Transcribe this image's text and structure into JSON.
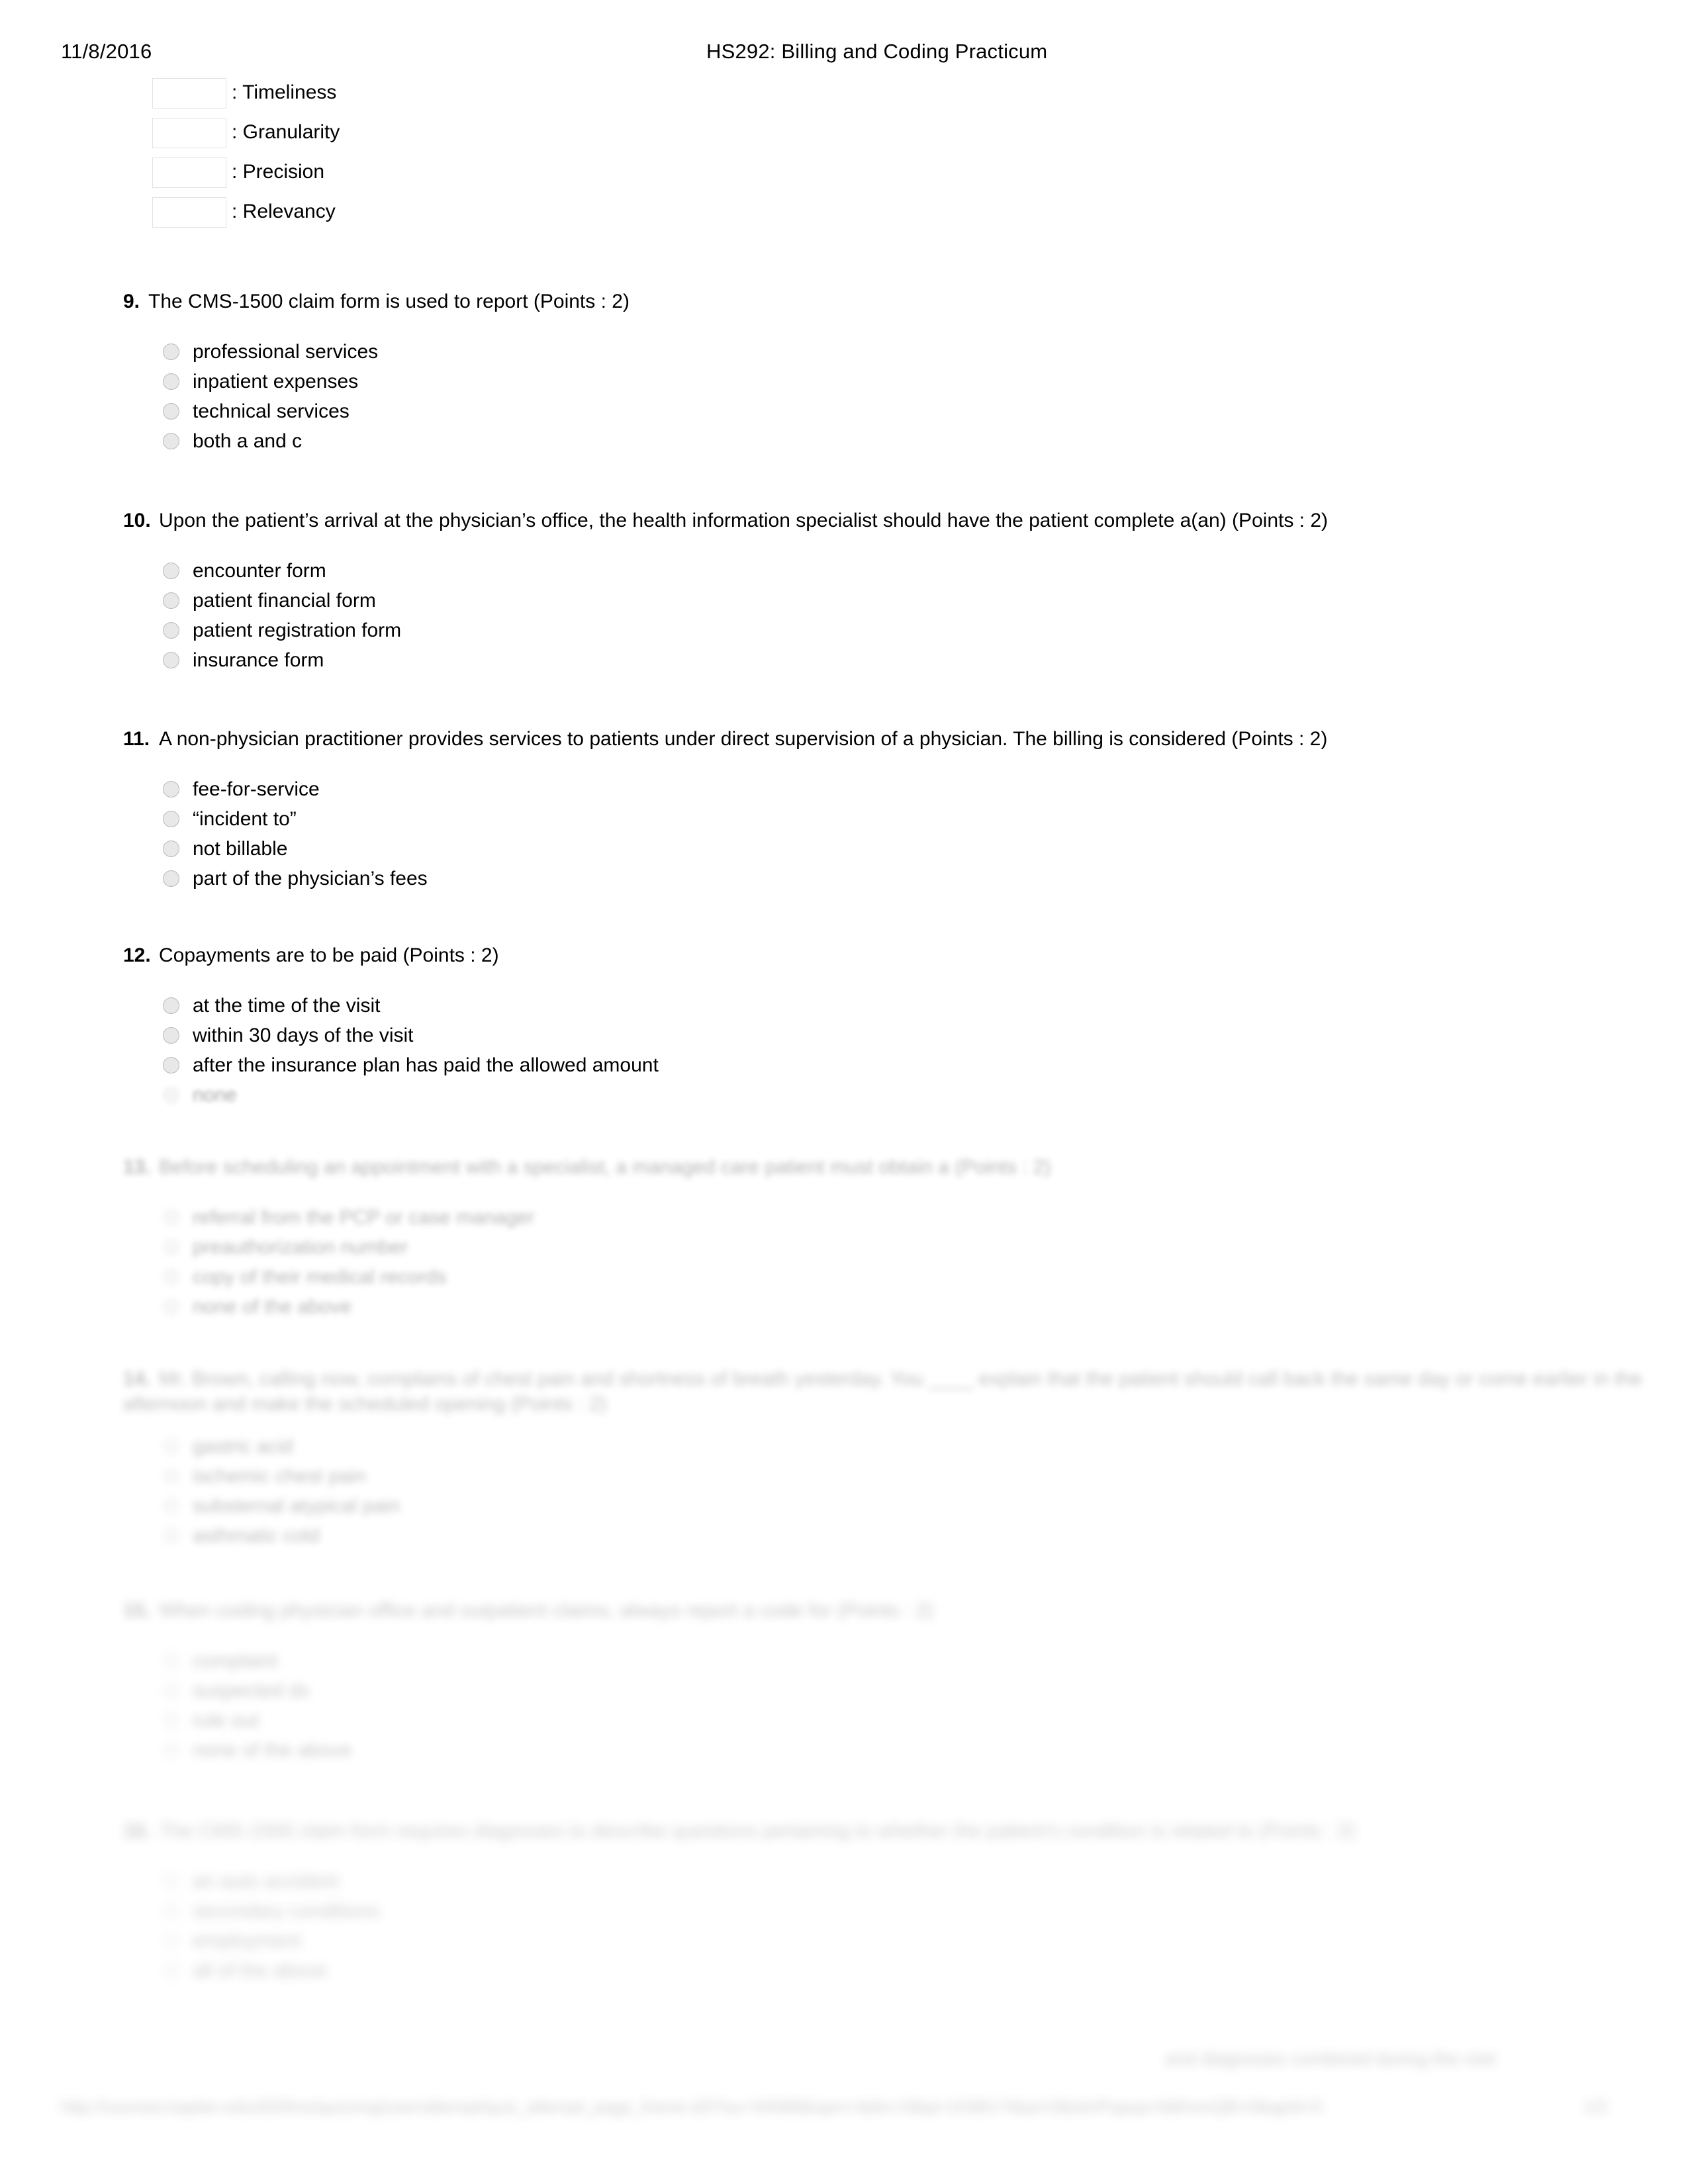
{
  "header": {
    "date": "11/8/2016",
    "title": "HS292: Billing and Coding Practicum"
  },
  "matching": {
    "rows": [
      {
        "blank_value": "",
        "label": ": Timeliness"
      },
      {
        "blank_value": "",
        "label": ": Granularity"
      },
      {
        "blank_value": "",
        "label": ": Precision"
      },
      {
        "blank_value": "",
        "label": ": Relevancy"
      }
    ]
  },
  "questions": [
    {
      "number": "9.",
      "text": "The CMS-1500 claim form is used to report (Points : 2)",
      "options": [
        "professional services",
        "inpatient expenses",
        "technical services",
        "both a and c"
      ]
    },
    {
      "number": "10.",
      "text": "Upon the patient’s arrival at the physician’s office, the health information specialist should have the patient complete a(an) (Points : 2)",
      "options": [
        "encounter form",
        "patient financial form",
        "patient registration form",
        "insurance form"
      ]
    },
    {
      "number": "11.",
      "text": "A non-physician practitioner provides services to patients under direct supervision of a physician. The billing is considered (Points : 2)",
      "options": [
        "fee-for-service",
        "“incident to”",
        "not billable",
        "part of the physician’s fees"
      ]
    },
    {
      "number": "12.",
      "text": "Copayments are to be paid (Points : 2)",
      "options": [
        "at the time of the visit",
        "within 30 days of the visit",
        "after the insurance plan has paid the allowed amount",
        "none"
      ]
    },
    {
      "number": "13.",
      "text": "Before scheduling an appointment with a specialist, a managed care patient must obtain a (Points : 2)",
      "options": [
        "referral from the PCP or case manager",
        "preauthorization number",
        "copy of their medical records",
        "none of the above"
      ]
    },
    {
      "number": "14.",
      "text": "Mr. Brown, calling now, complains of chest pain and shortness of breath yesterday. You ____ explain that the patient should call back the same day or come earlier in the",
      "text2": "afternoon and make the scheduled opening (Points : 2)",
      "options": [
        "gastric acid",
        "ischemic chest pain",
        "substernal atypical pain",
        "asthmatic cold"
      ]
    },
    {
      "number": "15.",
      "text": "When coding physician office and outpatient claims, always report a code for (Points : 2)",
      "options": [
        "complaint",
        "suspected dx",
        "rule out",
        "none of the above"
      ]
    },
    {
      "number": "16.",
      "text": "The CMS-1500 claim form requires diagnoses to describe questions pertaining to whether the patient’s condition is related to (Points : 2)",
      "options": [
        "an auto accident",
        "secondary conditions",
        "employment",
        "all of the above"
      ]
    }
  ],
  "footer": {
    "note": "and diagnoses combined during the visit",
    "url": "http://courses.kaplan.edu/d2l/lms/quizzing/user/attempt/quiz_attempt_page_frame.d2l?ou=34588&isprv=&drc=0&qi=1038174&ai=0&isInPopup=0&fromQB=0&qpId=0",
    "page": "1/2"
  }
}
